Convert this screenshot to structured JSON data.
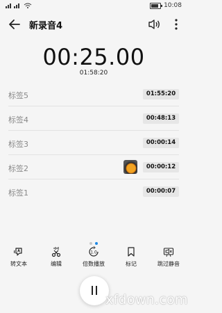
{
  "status_bar": {
    "signals": "ᵢₗₗ ᵢₗₗ",
    "time": "10:08"
  },
  "header": {
    "title": "新录音4"
  },
  "recording": {
    "elapsed": "00:25.00",
    "total": "01:58:20"
  },
  "tags": [
    {
      "label": "标签5",
      "time": "01:55:20",
      "has_photo": false
    },
    {
      "label": "标签4",
      "time": "00:48:13",
      "has_photo": false
    },
    {
      "label": "标签3",
      "time": "00:00:14",
      "has_photo": false
    },
    {
      "label": "标签2",
      "time": "00:00:12",
      "has_photo": true
    },
    {
      "label": "标签1",
      "time": "00:00:07",
      "has_photo": false
    }
  ],
  "pager": {
    "count": 2,
    "active": 1
  },
  "toolbar": {
    "items": [
      {
        "label": "转文本",
        "icon": "speech-to-text-icon"
      },
      {
        "label": "编辑",
        "icon": "scissors-icon"
      },
      {
        "label": "倍数播放",
        "icon": "playback-speed-icon"
      },
      {
        "label": "标记",
        "icon": "bookmark-icon"
      },
      {
        "label": "跳过静音",
        "icon": "skip-silence-icon"
      }
    ]
  },
  "watermark": "xfdown.com",
  "colors": {
    "accent": "#1e88e5",
    "background": "#f5f5f5",
    "tag_pill": "#e6e6e6"
  }
}
